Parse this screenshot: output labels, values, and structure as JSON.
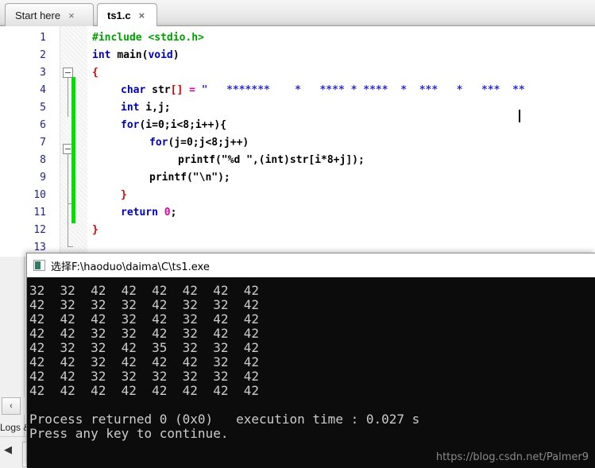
{
  "window": {
    "app": "Code::Blocks IDE"
  },
  "tabs": [
    {
      "label": "Start here",
      "close": "×",
      "active": false
    },
    {
      "label": "ts1.c",
      "close": "×",
      "active": true
    }
  ],
  "editor": {
    "line_numbers": [
      "1",
      "2",
      "3",
      "4",
      "5",
      "6",
      "7",
      "8",
      "9",
      "10",
      "11",
      "12",
      "13"
    ],
    "lines": [
      {
        "n": "1",
        "text": "#include <stdio.h>"
      },
      {
        "n": "2",
        "text": "int main(void)"
      },
      {
        "n": "3",
        "text": "{"
      },
      {
        "n": "4",
        "text": "    char str[] = \"   *******    *   **** * ****  *  ***   *   ***  **"
      },
      {
        "n": "5",
        "text": "    int i,j;"
      },
      {
        "n": "6",
        "text": "    for(i=0;i<8;i++){"
      },
      {
        "n": "7",
        "text": "        for(j=0;j<8;j++)"
      },
      {
        "n": "8",
        "text": "            printf(\"%d \",(int)str[i*8+j]);"
      },
      {
        "n": "9",
        "text": "        printf(\"\\n\");"
      },
      {
        "n": "10",
        "text": "    }"
      },
      {
        "n": "11",
        "text": "    return 0;"
      },
      {
        "n": "12",
        "text": "}"
      },
      {
        "n": "13",
        "text": ""
      }
    ],
    "tokens": {
      "line1": {
        "pre": "#include",
        "sp": " ",
        "hdr": "<stdio.h>"
      },
      "line2": {
        "kw": "int",
        "sp": " ",
        "fn": "main",
        "p1": "(",
        "kw2": "void",
        "p2": ")"
      },
      "line3": {
        "brace": "{"
      },
      "line4": {
        "kw": "char",
        "id": " str",
        "br": "[]",
        "eq": " = ",
        "quote": "\"",
        "stars": "   *******    *   **** * ****  *  ***   *   ***  **"
      },
      "line5": {
        "kw": "int",
        "id": " i,j;"
      },
      "line6": {
        "kw": "for",
        "rest": "(i=0;i<8;i++){"
      },
      "line7": {
        "kw": "for",
        "rest": "(j=0;j<8;j++)"
      },
      "line8": {
        "fn": "printf",
        "rest": "(\"%d \",(int)str[i*8+j]);"
      },
      "line9": {
        "fn": "printf",
        "rest": "(\"\\n\");"
      },
      "line10": {
        "brace": "}"
      },
      "line11": {
        "kw": "return",
        "num": " 0",
        "semi": ";"
      },
      "line12": {
        "brace": "}"
      }
    }
  },
  "console": {
    "title": "选择F:\\haoduo\\daima\\C\\ts1.exe",
    "icon": "console-window-icon",
    "grid": [
      [
        "32",
        "32",
        "42",
        "42",
        "42",
        "42",
        "42",
        "42"
      ],
      [
        "42",
        "32",
        "32",
        "32",
        "42",
        "32",
        "32",
        "42"
      ],
      [
        "42",
        "42",
        "42",
        "32",
        "42",
        "32",
        "42",
        "42"
      ],
      [
        "42",
        "42",
        "32",
        "32",
        "42",
        "32",
        "42",
        "42"
      ],
      [
        "42",
        "32",
        "32",
        "42",
        "35",
        "32",
        "32",
        "42"
      ],
      [
        "42",
        "42",
        "32",
        "42",
        "42",
        "42",
        "32",
        "42"
      ],
      [
        "42",
        "42",
        "32",
        "32",
        "32",
        "32",
        "32",
        "42"
      ],
      [
        "42",
        "42",
        "42",
        "42",
        "42",
        "42",
        "42",
        "42"
      ]
    ],
    "process_line": "Process returned 0 (0x0)   execution time : 0.027 s",
    "prompt_line": "Press any key to continue."
  },
  "statusbar": {
    "logs_label": "Logs &",
    "scroll_left": "‹",
    "bottom_arrow": "◀"
  },
  "watermark": "https://blog.csdn.net/Palmer9",
  "colors": {
    "accent_green": "#00e000",
    "console_bg": "#0c0c0c",
    "console_fg": "#cccccc",
    "keyword": "#0000c8",
    "preprocessor": "#00a000",
    "string": "#2b2bd4",
    "brace": "#dd0000",
    "number": "#e000a0"
  }
}
